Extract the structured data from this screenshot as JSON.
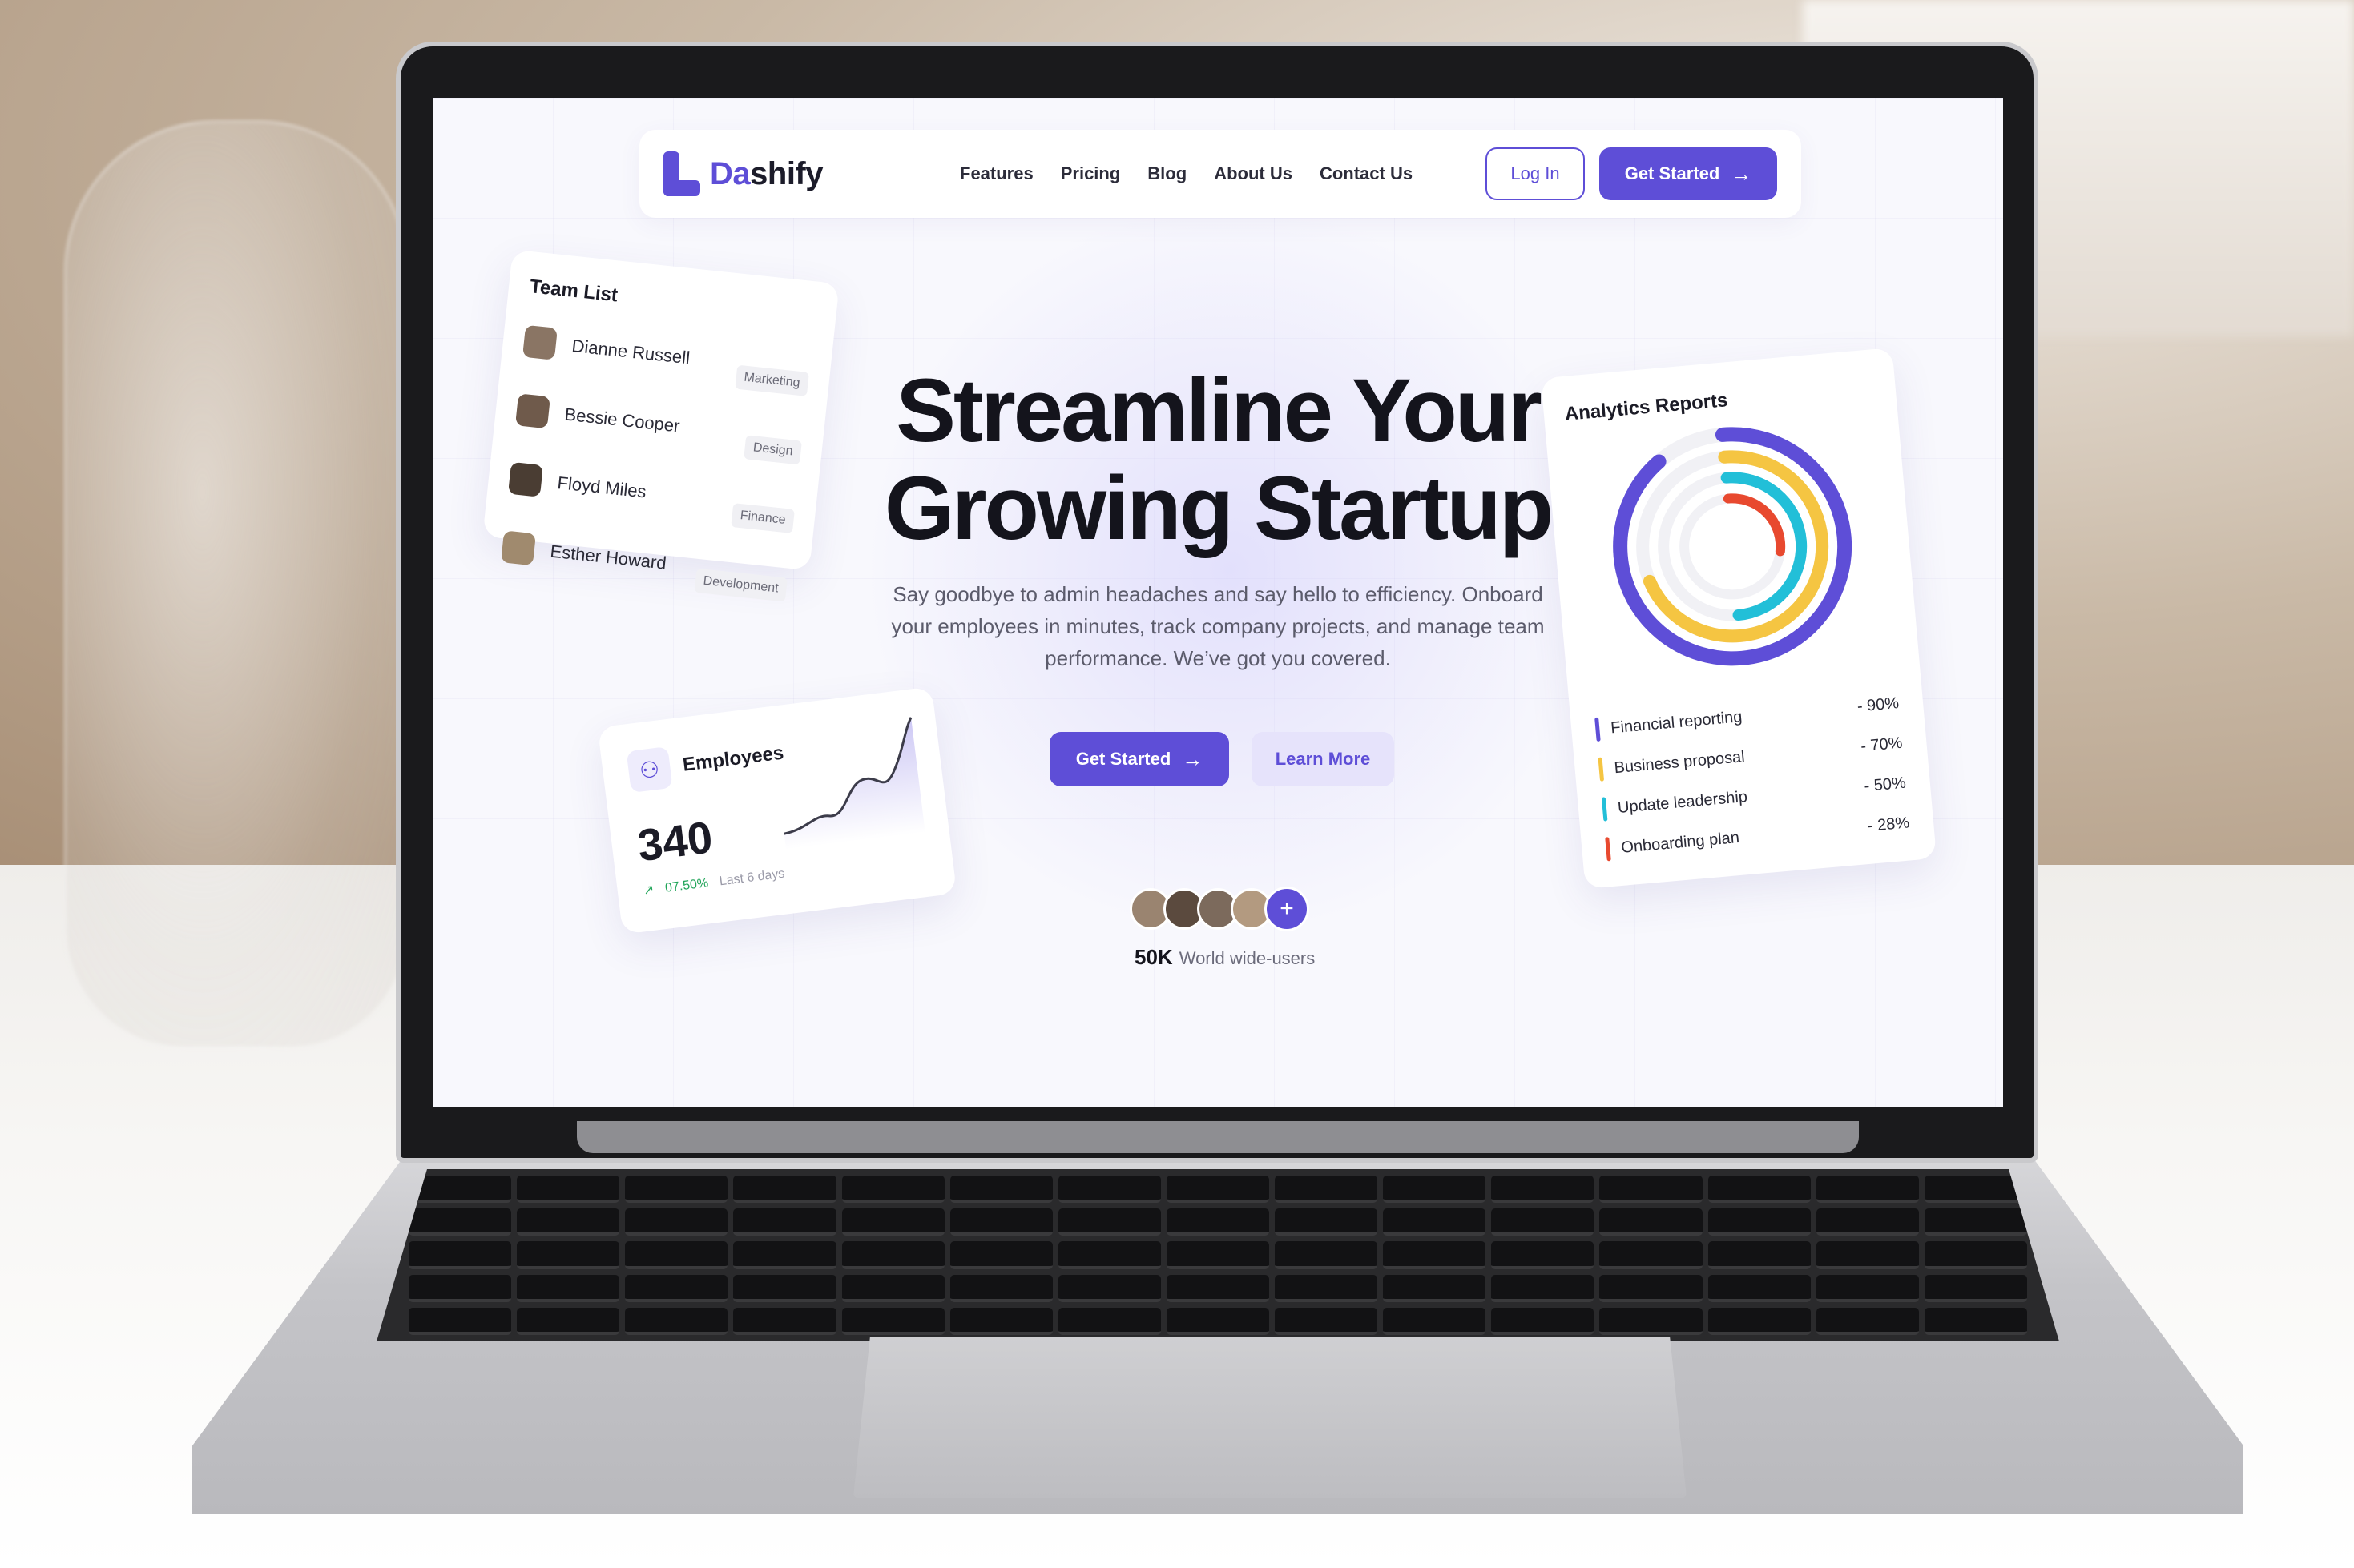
{
  "nav": {
    "brand_a": "Da",
    "brand_b": "shify",
    "links": [
      "Features",
      "Pricing",
      "Blog",
      "About Us",
      "Contact Us"
    ],
    "login": "Log In",
    "get_started": "Get Started"
  },
  "hero": {
    "title_line1": "Streamline Your",
    "title_line2": "Growing Startup",
    "subtitle": "Say goodbye to admin headaches and say hello to efficiency. Onboard your employees in minutes, track company projects, and manage team performance. We’ve got you covered.",
    "cta_primary": "Get Started",
    "cta_secondary": "Learn More",
    "users_count": "50K",
    "users_label": "World wide-users"
  },
  "team_list": {
    "title": "Team List",
    "members": [
      {
        "name": "Dianne Russell",
        "dept": "Marketing"
      },
      {
        "name": "Bessie Cooper",
        "dept": "Design"
      },
      {
        "name": "Floyd Miles",
        "dept": "Finance"
      },
      {
        "name": "Esther Howard",
        "dept": "Development"
      }
    ]
  },
  "employees": {
    "title": "Employees",
    "count": "340",
    "change": "07.50%",
    "period": "Last 6 days"
  },
  "analytics": {
    "title": "Analytics Reports",
    "items": [
      {
        "label": "Financial reporting",
        "pct": "- 90%",
        "value": 90,
        "color": "#5e4ed7"
      },
      {
        "label": "Business proposal",
        "pct": "- 70%",
        "value": 70,
        "color": "#f5c542"
      },
      {
        "label": "Update leadership",
        "pct": "- 50%",
        "value": 50,
        "color": "#22bfd8"
      },
      {
        "label": "Onboarding plan",
        "pct": "- 28%",
        "value": 28,
        "color": "#e8492f"
      }
    ]
  },
  "colors": {
    "accent": "#5e4ed7",
    "positive": "#22a55a"
  }
}
